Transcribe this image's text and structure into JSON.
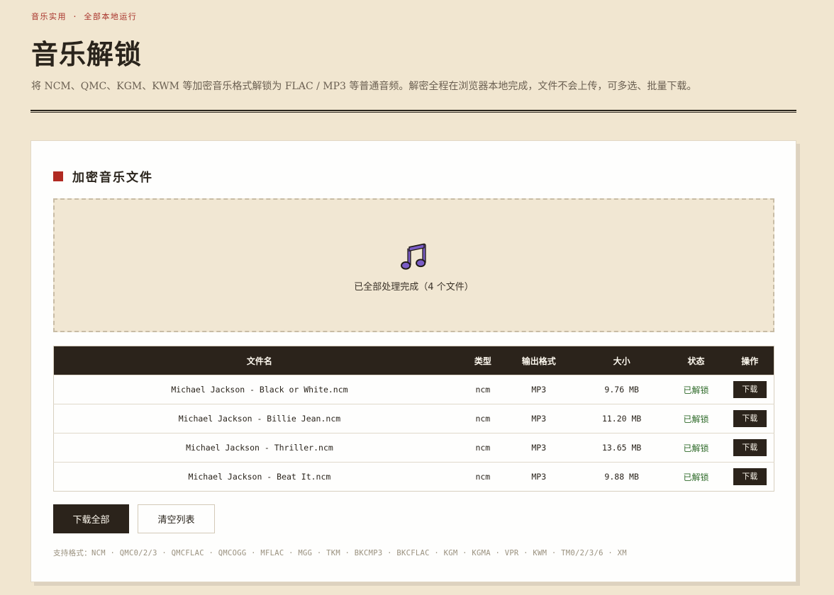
{
  "header": {
    "eyebrow": "音乐实用 · 全部本地运行",
    "title": "音乐解锁",
    "subtitle": "将 NCM、QMC、KGM、KWM 等加密音乐格式解锁为 FLAC / MP3 等普通音频。解密全程在浏览器本地完成，文件不会上传，可多选、批量下载。"
  },
  "card": {
    "title": "加密音乐文件",
    "accent": "#b12a22"
  },
  "dropzone": {
    "icon": "music-note-icon",
    "icon_color": "#7a5cc6",
    "status": "已全部处理完成（4 个文件）"
  },
  "table": {
    "headers": {
      "name": "文件名",
      "type": "类型",
      "output": "输出格式",
      "size": "大小",
      "state": "状态",
      "action": "操作"
    },
    "rows": [
      {
        "name": "Michael Jackson - Black or White.ncm",
        "type": "ncm",
        "output": "MP3",
        "size": "9.76 MB",
        "state": "已解锁",
        "action": "下载"
      },
      {
        "name": "Michael Jackson - Billie Jean.ncm",
        "type": "ncm",
        "output": "MP3",
        "size": "11.20 MB",
        "state": "已解锁",
        "action": "下载"
      },
      {
        "name": "Michael Jackson - Thriller.ncm",
        "type": "ncm",
        "output": "MP3",
        "size": "13.65 MB",
        "state": "已解锁",
        "action": "下载"
      },
      {
        "name": "Michael Jackson - Beat It.ncm",
        "type": "ncm",
        "output": "MP3",
        "size": "9.88 MB",
        "state": "已解锁",
        "action": "下载"
      }
    ]
  },
  "actions": {
    "download_all": "下载全部",
    "clear_list": "清空列表"
  },
  "formats": "支持格式：NCM · QMC0/2/3 · QMCFLAC · QMCOGG · MFLAC · MGG · TKM · BKCMP3 · BKCFLAC · KGM · KGMA · VPR · KWM · TM0/2/3/6 · XM"
}
